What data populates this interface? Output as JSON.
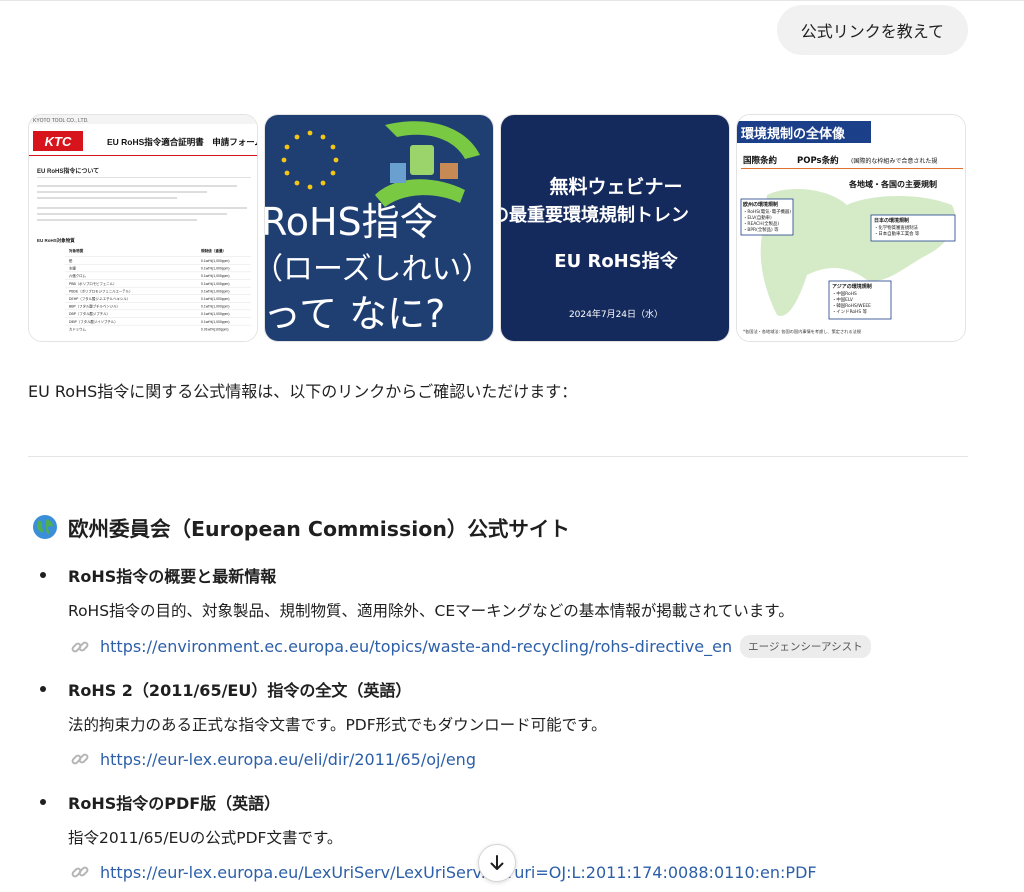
{
  "user_message": "公式リンクを教えて",
  "images": {
    "ktc": {
      "logo": "KTC",
      "company": "KYOTO TOOL CO., LTD.",
      "title": "EU RoHS指令適合証明書　申請フォーム",
      "heading": "EU RoHS指令について",
      "table_heading": "EU RoHS対象物質",
      "col1": "対象物質",
      "col2": "規制値（重量）",
      "rows": [
        [
          "鉛",
          "0.1wt%(1,000ppm)"
        ],
        [
          "水銀",
          "0.1wt%(1,000ppm)"
        ],
        [
          "六価クロム",
          "0.1wt%(1,000ppm)"
        ],
        [
          "PBB（ポリブロモビフェニル）",
          "0.1wt%(1,000ppm)"
        ],
        [
          "PBDE（ポリブロモジフェニルエーテル）",
          "0.1wt%(1,000ppm)"
        ],
        [
          "DEHP（フタル酸ジ-2-エチルヘキシル）",
          "0.1wt%(1,000ppm)"
        ],
        [
          "BBP（フタル酸ブチルベンジル）",
          "0.1wt%(1,000ppm)"
        ],
        [
          "DBP（フタル酸ジブチル）",
          "0.1wt%(1,000ppm)"
        ],
        [
          "DIBP（フタル酸ジイソブチル）",
          "0.1wt%(1,000ppm)"
        ],
        [
          "カドミウム",
          "0.01wt%(100ppm)"
        ]
      ]
    },
    "rohs": {
      "line1": "RoHS指令",
      "line2": "（ローズしれい）",
      "line3": "って なに?"
    },
    "webinar": {
      "line1": "無料ウェビナー",
      "line2": "の最重要環境規制トレン",
      "line3": "EU RoHS指令",
      "date": "2024年7月24日（水）"
    },
    "map": {
      "title": "環境規制の全体像",
      "treaty1": "国際条約",
      "treaty2": "POPs条約",
      "treaty_note": "(国際的な枠組みで合意された規",
      "regional": "各地域・各国の主要規制",
      "eu_box": "欧州の環境規制",
      "eu_items": [
        "・RoHS(電気･電子機器)",
        "・ELV(自動車)",
        "・REACH(全製品)",
        "・BPR(全製品) 等"
      ],
      "jp_box": "日本の環境規制",
      "jp_items": [
        "・化学物質審査規制法",
        "・日本自動車工業会 等"
      ],
      "asia_box": "アジアの環境規制",
      "asia_items": [
        "・中国RoHS",
        "・中国ELV",
        "・韓国RoHS/WEEE",
        "・インドRoHS 等"
      ],
      "footnote": "*各国法・各地域法: 各国の国内事情を考慮し、策定される法規"
    }
  },
  "intro_text": "EU RoHS指令に関する公式情報は、以下のリンクからご確認いただけます：",
  "section": {
    "title": "欧州委員会（European Commission）公式サイト",
    "items": [
      {
        "heading": "RoHS指令の概要と最新情報",
        "description": "RoHS指令の目的、対象製品、規制物質、適用除外、CEマーキングなどの基本情報が掲載されています。",
        "link": "https://environment.ec.europa.eu/topics/waste-and-recycling/rohs-directive_en",
        "tag": "エージェンシーアシスト"
      },
      {
        "heading": "RoHS 2（2011/65/EU）指令の全文（英語）",
        "description": "法的拘束力のある正式な指令文書です。PDF形式でもダウンロード可能です。",
        "link": "https://eur-lex.europa.eu/eli/dir/2011/65/oj/eng"
      },
      {
        "heading": "RoHS指令のPDF版（英語）",
        "description": "指令2011/65/EUの公式PDF文書です。",
        "link": "https://eur-lex.europa.eu/LexUriServ/LexUriServ.do?uri=OJ:L:2011:174:0088:0110:en:PDF"
      }
    ]
  }
}
